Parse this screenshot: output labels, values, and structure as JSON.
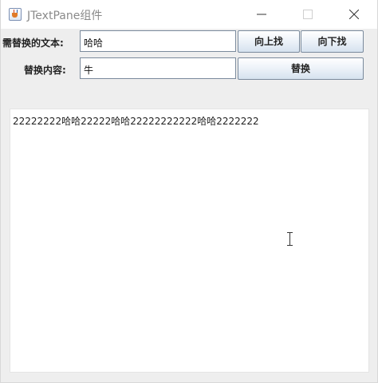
{
  "window": {
    "title": "JTextPane组件",
    "icon": "java-cup-icon",
    "controls": {
      "minimize": "minimize-icon",
      "maximize": "maximize-icon",
      "close": "close-icon"
    }
  },
  "form": {
    "search_label": "需替换的文本:",
    "search_value": "哈哈",
    "replace_label": "替换内容:",
    "replace_value": "牛",
    "find_up_label": "向上找",
    "find_down_label": "向下找",
    "replace_button_label": "替换"
  },
  "text_pane": {
    "content": "22222222哈哈22222哈哈22222222222哈哈2222222",
    "cursor": "ibeam-cursor-icon"
  },
  "colors": {
    "window_bg": "#eeeeee",
    "titlebar_bg": "#ffffff",
    "button_top": "#ffffff",
    "button_bottom": "#d6e2ef",
    "field_border": "#7a8a9c"
  }
}
